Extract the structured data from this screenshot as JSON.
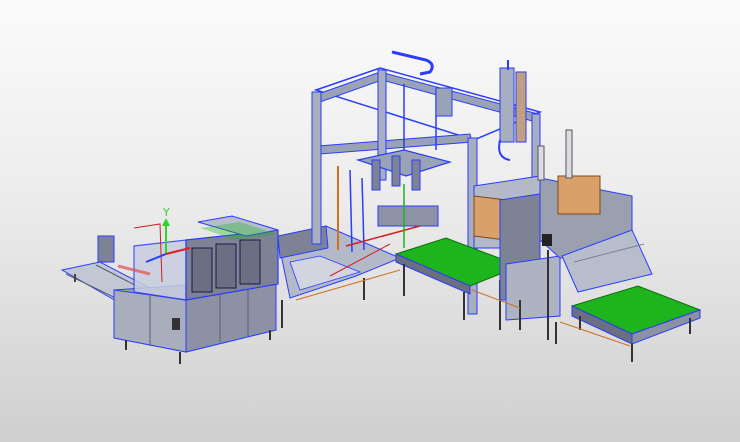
{
  "viewport": {
    "background_top": "#fbfbfb",
    "background_bottom": "#cfcfcf"
  },
  "triad": {
    "y_label": "Y",
    "x_color": "#e02020",
    "y_color": "#2bd62b",
    "z_color": "#2040ff"
  },
  "colors": {
    "frame": "#9aa3b5",
    "frame_edge": "#2a3cff",
    "panel": "#aeb3c2",
    "panel_dark": "#7d8394",
    "glass": "#c8cde0",
    "conveyor_green": "#1db41d",
    "cardboard": "#d9a06a",
    "accent_red": "#d02020"
  }
}
